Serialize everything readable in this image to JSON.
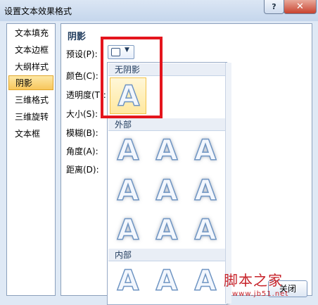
{
  "window": {
    "title": "设置文本效果格式",
    "help_label": "?",
    "close_label": "✕"
  },
  "nav": {
    "items": [
      {
        "label": "文本填充"
      },
      {
        "label": "文本边框"
      },
      {
        "label": "大纲样式"
      },
      {
        "label": "阴影",
        "active": true
      },
      {
        "label": "三维格式"
      },
      {
        "label": "三维旋转"
      },
      {
        "label": "文本框"
      }
    ]
  },
  "panel": {
    "section_title": "阴影",
    "preset_label": "预设(P):",
    "color_label": "颜色(C):",
    "transparency_label": "透明度(T):",
    "size_label": "大小(S):",
    "blur_label": "模糊(B):",
    "angle_label": "角度(A):",
    "distance_label": "距离(D):"
  },
  "gallery": {
    "groups": [
      {
        "name": "无阴影",
        "cells": [
          "A"
        ]
      },
      {
        "name": "外部",
        "cells": [
          "A",
          "A",
          "A",
          "A",
          "A",
          "A",
          "A",
          "A",
          "A"
        ]
      },
      {
        "name": "内部",
        "cells": [
          "A",
          "A",
          "A"
        ]
      }
    ],
    "selected_group": "无阴影"
  },
  "footer": {
    "close_label": "关闭"
  },
  "watermark": {
    "brand": "脚本之家",
    "url": "www.jb51.net"
  },
  "colors": {
    "highlight": "#e4151d",
    "selected_fill": "#ffe8a0"
  }
}
